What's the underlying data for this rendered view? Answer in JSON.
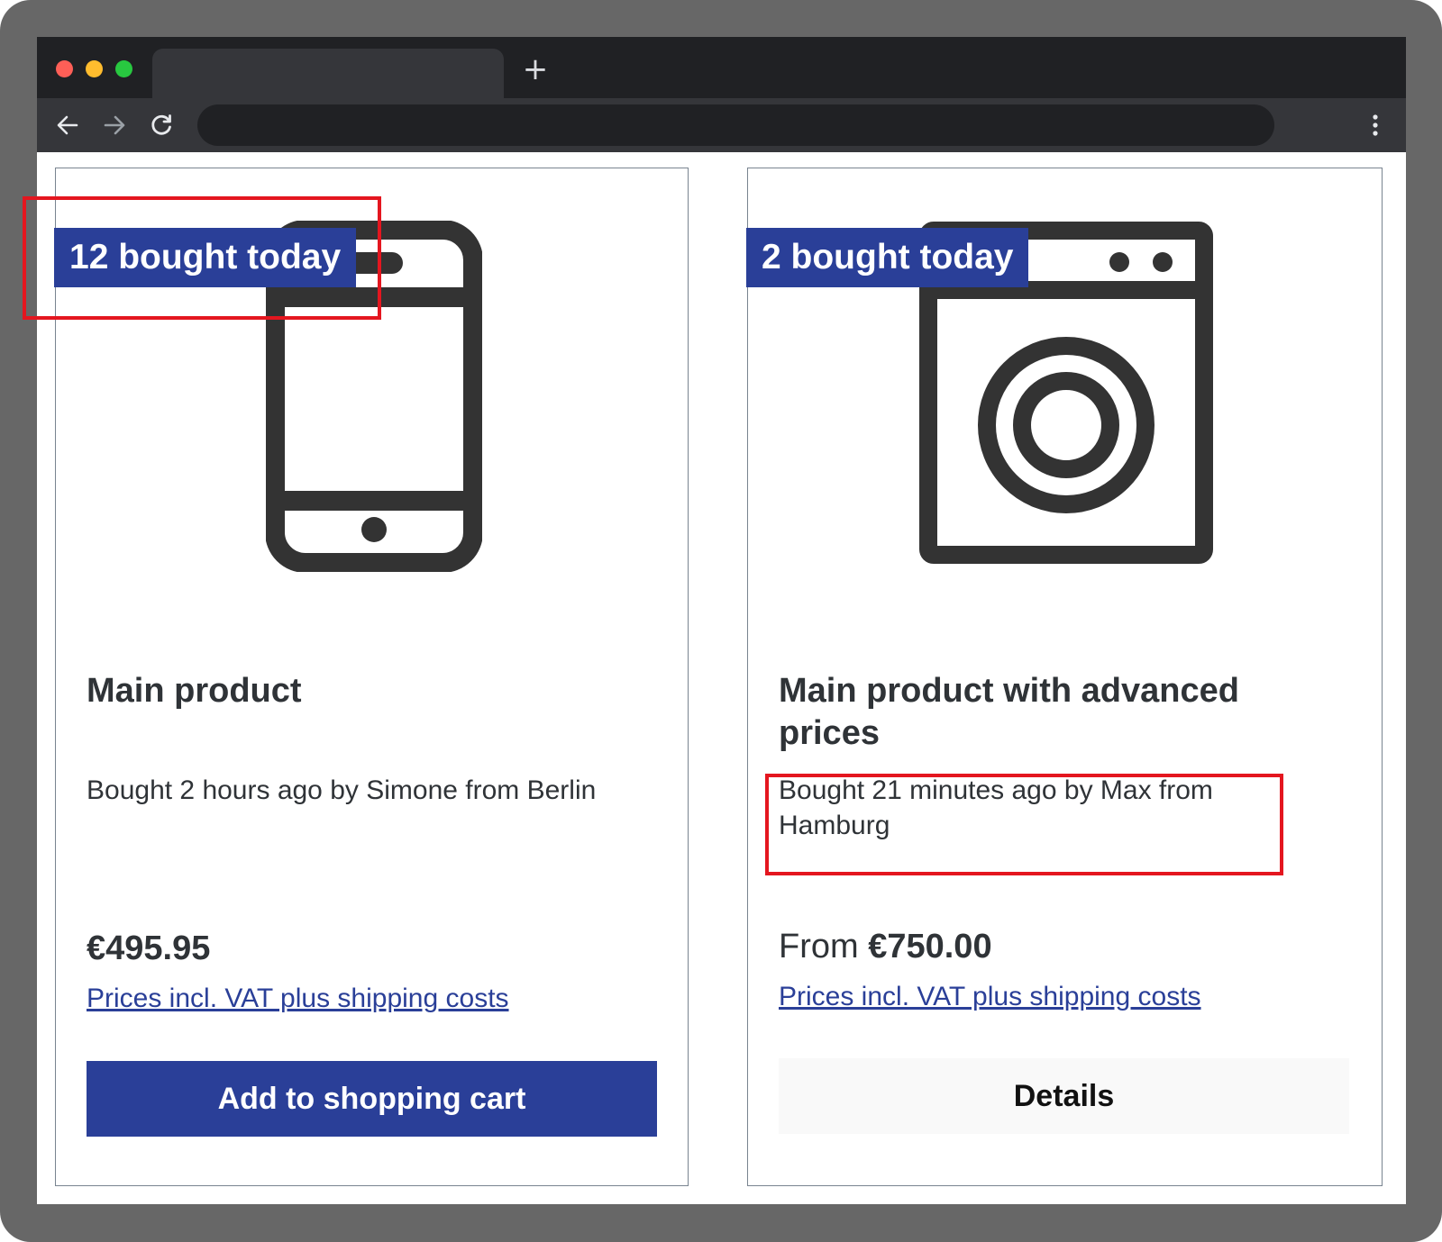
{
  "browser": {
    "new_tab_symbol": "+",
    "icons": [
      "back-arrow-icon",
      "forward-arrow-icon",
      "reload-icon",
      "more-menu-icon"
    ]
  },
  "products": [
    {
      "badge": "12 bought today",
      "image_icon": "smartphone-icon",
      "title": "Main product",
      "social_proof": "Bought 2 hours ago by Simone from Berlin",
      "price_prefix": "",
      "price": "€495.95",
      "vat_link": "Prices incl. VAT plus shipping costs",
      "button": "Add to shopping cart"
    },
    {
      "badge": "2 bought today",
      "image_icon": "washing-machine-icon",
      "title": "Main product with advanced prices",
      "social_proof": "Bought 21 minutes ago by Max from Hamburg",
      "price_prefix": "From",
      "price": "€750.00",
      "vat_link": "Prices incl. VAT plus shipping costs",
      "button": "Details"
    }
  ],
  "colors": {
    "brand_blue": "#2a3f98",
    "highlight_red": "#e4161f",
    "text_dark": "#2f3337",
    "device_frame": "#676767",
    "chrome_dark": "#202124",
    "chrome_tab": "#35363a"
  }
}
